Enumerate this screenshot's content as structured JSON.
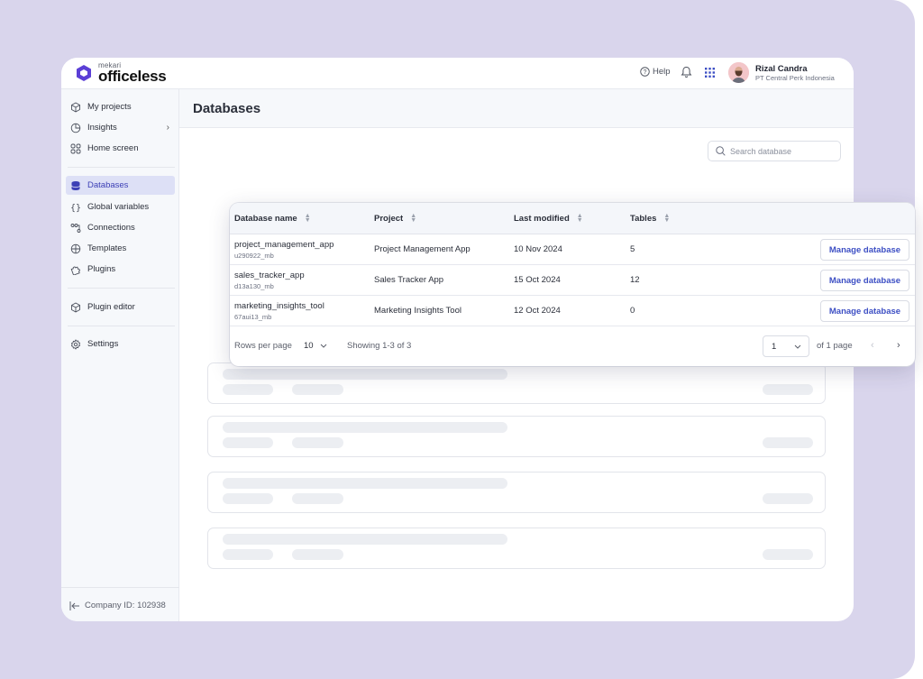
{
  "header": {
    "logo_small": "mekari",
    "logo_big": "officeless",
    "help_label": "Help",
    "user_name": "Rizal Candra",
    "user_org": "PT Central Perk Indonesia"
  },
  "sidebar": {
    "items": [
      {
        "label": "My projects",
        "icon": "cube-icon"
      },
      {
        "label": "Insights",
        "icon": "pie-chart-icon"
      },
      {
        "label": "Home screen",
        "icon": "grid-four-icon"
      },
      {
        "label": "Databases",
        "icon": "database-icon"
      },
      {
        "label": "Global variables",
        "icon": "braces-icon"
      },
      {
        "label": "Connections",
        "icon": "connections-icon"
      },
      {
        "label": "Templates",
        "icon": "templates-icon"
      },
      {
        "label": "Plugins",
        "icon": "puzzle-icon"
      },
      {
        "label": "Plugin editor",
        "icon": "cube-edit-icon"
      },
      {
        "label": "Settings",
        "icon": "gear-icon"
      }
    ],
    "active": "Databases",
    "company_id": "Company ID: 102938"
  },
  "main": {
    "title": "Databases",
    "search_placeholder": "Search database"
  },
  "table": {
    "columns": [
      "Database name",
      "Project",
      "Last modified",
      "Tables"
    ],
    "rows": [
      {
        "name": "project_management_app",
        "id": "u290922_mb",
        "project": "Project Management App",
        "modified": "10 Nov 2024",
        "tables": "5",
        "action": "Manage database"
      },
      {
        "name": "sales_tracker_app",
        "id": "d13a130_mb",
        "project": "Sales Tracker App",
        "modified": "15 Oct 2024",
        "tables": "12",
        "action": "Manage database"
      },
      {
        "name": "marketing_insights_tool",
        "id": "67aui13_mb",
        "project": "Marketing Insights Tool",
        "modified": "12 Oct 2024",
        "tables": "0",
        "action": "Manage database"
      }
    ],
    "footer": {
      "rows_per_page_label": "Rows per page",
      "rows_per_page_value": "10",
      "showing": "Showing 1-3 of 3",
      "page_value": "1",
      "page_total": "of 1 page"
    }
  },
  "colors": {
    "backdrop": "#d9d5ec",
    "accent": "#3d40b6",
    "logo": "#5b3fd6",
    "active_bg": "#dde0f6"
  }
}
